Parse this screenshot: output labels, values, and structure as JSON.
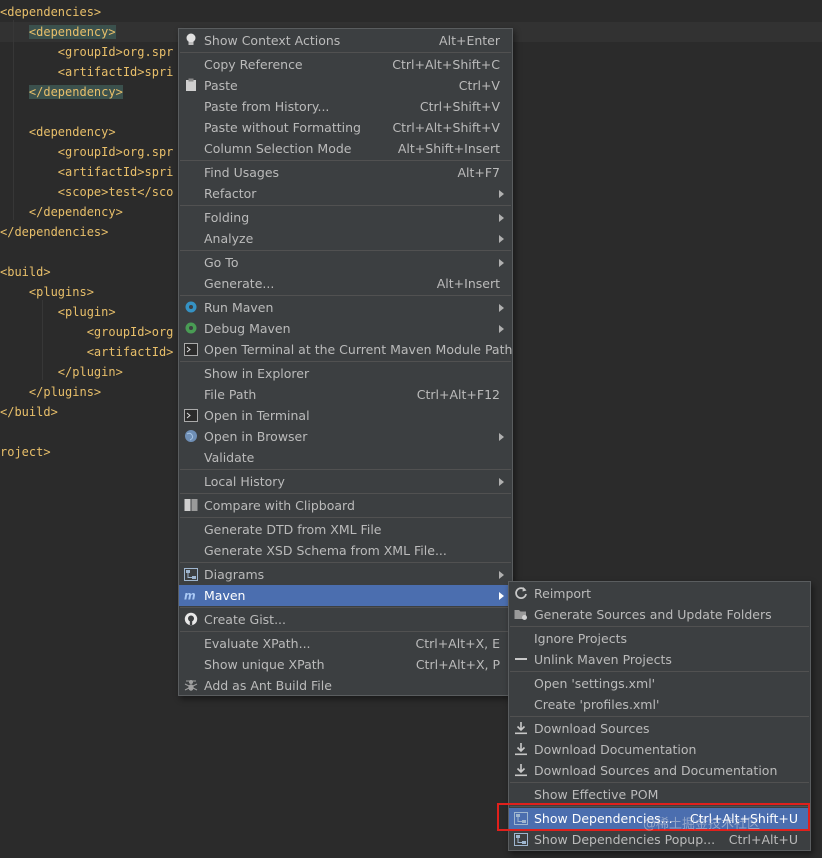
{
  "editor": {
    "lines": [
      {
        "indent": "",
        "text": "<dependencies>"
      },
      {
        "indent": "    ",
        "text": "<dependency>",
        "highlight": true
      },
      {
        "indent": "        ",
        "text": "<groupId>org.spr"
      },
      {
        "indent": "        ",
        "text": "<artifactId>spri"
      },
      {
        "indent": "    ",
        "text": "</dependency>",
        "highlight": true
      },
      {
        "indent": "",
        "text": ""
      },
      {
        "indent": "    ",
        "text": "<dependency>"
      },
      {
        "indent": "        ",
        "text": "<groupId>org.spr"
      },
      {
        "indent": "        ",
        "text": "<artifactId>spri"
      },
      {
        "indent": "        ",
        "text": "<scope>test</sco"
      },
      {
        "indent": "    ",
        "text": "</dependency>"
      },
      {
        "indent": "",
        "text": "</dependencies>"
      },
      {
        "indent": "",
        "text": ""
      },
      {
        "indent": "",
        "text": "<build>"
      },
      {
        "indent": "    ",
        "text": "<plugins>"
      },
      {
        "indent": "        ",
        "text": "<plugin>"
      },
      {
        "indent": "            ",
        "text": "<groupId>org"
      },
      {
        "indent": "            ",
        "text": "<artifactId>"
      },
      {
        "indent": "        ",
        "text": "</plugin>"
      },
      {
        "indent": "    ",
        "text": "</plugins>"
      },
      {
        "indent": "",
        "text": "</build>"
      },
      {
        "indent": "",
        "text": ""
      },
      {
        "indent": "",
        "text": "roject>"
      }
    ]
  },
  "context_menu": {
    "items": [
      {
        "label": "Show Context Actions",
        "shortcut": "Alt+Enter",
        "icon": "lightbulb-icon"
      },
      {
        "sep": true
      },
      {
        "label": "Copy Reference",
        "shortcut": "Ctrl+Alt+Shift+C"
      },
      {
        "label": "Paste",
        "shortcut": "Ctrl+V",
        "icon": "clipboard-icon"
      },
      {
        "label": "Paste from History...",
        "shortcut": "Ctrl+Shift+V"
      },
      {
        "label": "Paste without Formatting",
        "shortcut": "Ctrl+Alt+Shift+V"
      },
      {
        "label": "Column Selection Mode",
        "shortcut": "Alt+Shift+Insert"
      },
      {
        "sep": true
      },
      {
        "label": "Find Usages",
        "shortcut": "Alt+F7"
      },
      {
        "label": "Refactor",
        "submenu": true
      },
      {
        "sep": true
      },
      {
        "label": "Folding",
        "submenu": true
      },
      {
        "label": "Analyze",
        "submenu": true
      },
      {
        "sep": true
      },
      {
        "label": "Go To",
        "submenu": true
      },
      {
        "label": "Generate...",
        "shortcut": "Alt+Insert"
      },
      {
        "sep": true
      },
      {
        "label": "Run Maven",
        "submenu": true,
        "icon": "gear-blue-icon"
      },
      {
        "label": "Debug Maven",
        "submenu": true,
        "icon": "gear-green-icon"
      },
      {
        "label": "Open Terminal at the Current Maven Module Path",
        "icon": "terminal-icon"
      },
      {
        "sep": true
      },
      {
        "label": "Show in Explorer"
      },
      {
        "label": "File Path",
        "shortcut": "Ctrl+Alt+F12"
      },
      {
        "label": "Open in Terminal",
        "icon": "terminal-icon"
      },
      {
        "label": "Open in Browser",
        "submenu": true,
        "icon": "globe-icon"
      },
      {
        "label": "Validate"
      },
      {
        "sep": true
      },
      {
        "label": "Local History",
        "submenu": true
      },
      {
        "sep": true
      },
      {
        "label": "Compare with Clipboard",
        "icon": "compare-icon"
      },
      {
        "sep": true
      },
      {
        "label": "Generate DTD from XML File"
      },
      {
        "label": "Generate XSD Schema from XML File..."
      },
      {
        "sep": true
      },
      {
        "label": "Diagrams",
        "submenu": true,
        "icon": "diagram-icon"
      },
      {
        "label": "Maven",
        "submenu": true,
        "icon": "maven-icon",
        "selected": true
      },
      {
        "sep": true
      },
      {
        "label": "Create Gist...",
        "icon": "github-icon"
      },
      {
        "sep": true
      },
      {
        "label": "Evaluate XPath...",
        "shortcut": "Ctrl+Alt+X, E"
      },
      {
        "label": "Show unique XPath",
        "shortcut": "Ctrl+Alt+X, P"
      },
      {
        "label": "Add as Ant Build File",
        "icon": "ant-icon"
      }
    ]
  },
  "maven_submenu": {
    "items": [
      {
        "label": "Reimport",
        "icon": "reimport-icon"
      },
      {
        "label": "Generate Sources and Update Folders",
        "icon": "folder-gen-icon"
      },
      {
        "sep": true
      },
      {
        "label": "Ignore Projects"
      },
      {
        "label": "Unlink Maven Projects",
        "icon": "minus-icon"
      },
      {
        "sep": true
      },
      {
        "label": "Open 'settings.xml'"
      },
      {
        "label": "Create 'profiles.xml'"
      },
      {
        "sep": true
      },
      {
        "label": "Download Sources",
        "icon": "download-icon"
      },
      {
        "label": "Download Documentation",
        "icon": "download-icon"
      },
      {
        "label": "Download Sources and Documentation",
        "icon": "download-icon"
      },
      {
        "sep": true
      },
      {
        "label": "Show Effective POM"
      },
      {
        "sep": true
      },
      {
        "label": "Show Dependencies...",
        "shortcut": "Ctrl+Alt+Shift+U",
        "icon": "diagram-icon",
        "selected": true
      },
      {
        "label": "Show Dependencies Popup...",
        "shortcut": "Ctrl+Alt+U",
        "icon": "diagram-icon"
      }
    ]
  },
  "watermark": "@稀土掘金技术社区",
  "colors": {
    "selection": "#4b6eaf",
    "tag": "#e8bf6a",
    "highlight_box": "#e0201c"
  }
}
